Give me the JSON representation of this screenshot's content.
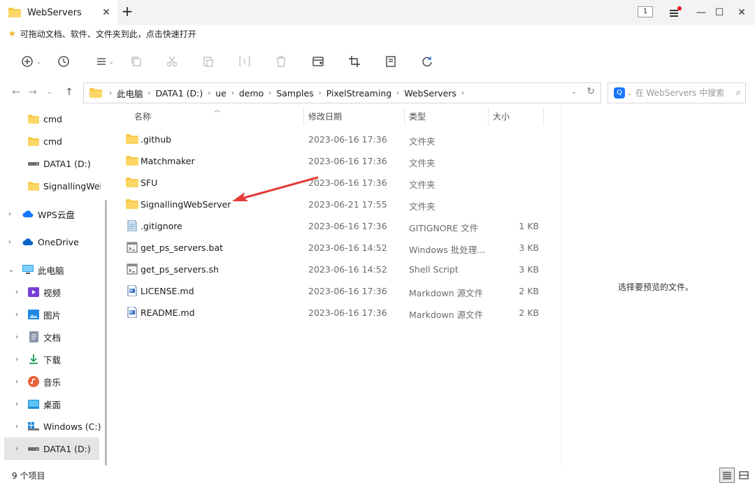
{
  "window": {
    "tab_title": "WebServers",
    "badge_count": "1",
    "notification_color": "#e81123"
  },
  "favorites": {
    "hint": "可拖动文档、软件、文件夹到此，点击快速打开"
  },
  "toolbar": {
    "buttons": [
      "new-icon",
      "history-icon",
      "view-list-icon",
      "copy-icon",
      "cut-icon",
      "paste-icon",
      "rename-icon",
      "delete-icon",
      "share-icon",
      "crop-icon",
      "properties-icon",
      "sync-icon"
    ]
  },
  "address": {
    "breadcrumbs": [
      "此电脑",
      "DATA1 (D:)",
      "ue",
      "demo",
      "Samples",
      "PixelStreaming",
      "WebServers"
    ]
  },
  "search": {
    "placeholder": "在 WebServers 中搜索"
  },
  "sidebar": {
    "items": [
      {
        "label": "cmd",
        "icon": "folder-icon"
      },
      {
        "label": "cmd",
        "icon": "folder-icon"
      },
      {
        "label": "DATA1 (D:)",
        "icon": "drive-icon"
      },
      {
        "label": "SignallingWebServer",
        "icon": "folder-icon"
      },
      {
        "label": "WPS云盘",
        "icon": "cloud-icon"
      },
      {
        "label": "OneDrive",
        "icon": "onedrive-icon"
      },
      {
        "label": "此电脑",
        "icon": "computer-icon"
      },
      {
        "label": "视频",
        "icon": "video-icon"
      },
      {
        "label": "图片",
        "icon": "picture-icon"
      },
      {
        "label": "文档",
        "icon": "document-icon"
      },
      {
        "label": "下载",
        "icon": "download-icon"
      },
      {
        "label": "音乐",
        "icon": "music-icon"
      },
      {
        "label": "桌面",
        "icon": "desktop-icon"
      },
      {
        "label": "Windows (C:)",
        "icon": "windows-drive-icon"
      },
      {
        "label": "DATA1 (D:)",
        "icon": "drive-icon"
      }
    ]
  },
  "columns": {
    "name": "名称",
    "date": "修改日期",
    "type": "类型",
    "size": "大小"
  },
  "files": [
    {
      "name": ".github",
      "date": "2023-06-16 17:36",
      "type": "文件夹",
      "size": "",
      "icon": "folder-icon"
    },
    {
      "name": "Matchmaker",
      "date": "2023-06-16 17:36",
      "type": "文件夹",
      "size": "",
      "icon": "folder-icon"
    },
    {
      "name": "SFU",
      "date": "2023-06-16 17:36",
      "type": "文件夹",
      "size": "",
      "icon": "folder-icon"
    },
    {
      "name": "SignallingWebServer",
      "date": "2023-06-21 17:55",
      "type": "文件夹",
      "size": "",
      "icon": "folder-icon"
    },
    {
      "name": ".gitignore",
      "date": "2023-06-16 17:36",
      "type": "GITIGNORE 文件",
      "size": "1 KB",
      "icon": "text-file-icon"
    },
    {
      "name": "get_ps_servers.bat",
      "date": "2023-06-16 14:52",
      "type": "Windows 批处理...",
      "size": "3 KB",
      "icon": "script-file-icon"
    },
    {
      "name": "get_ps_servers.sh",
      "date": "2023-06-16 14:52",
      "type": "Shell Script",
      "size": "3 KB",
      "icon": "script-file-icon"
    },
    {
      "name": "LICENSE.md",
      "date": "2023-06-16 17:36",
      "type": "Markdown 源文件",
      "size": "2 KB",
      "icon": "markdown-file-icon"
    },
    {
      "name": "README.md",
      "date": "2023-06-16 17:36",
      "type": "Markdown 源文件",
      "size": "2 KB",
      "icon": "markdown-file-icon"
    }
  ],
  "annotation": {
    "arrow_color": "#e53935",
    "points_to": "SignallingWebServer"
  },
  "preview": {
    "empty_text": "选择要预览的文件。"
  },
  "status": {
    "item_count": "9 个项目"
  }
}
